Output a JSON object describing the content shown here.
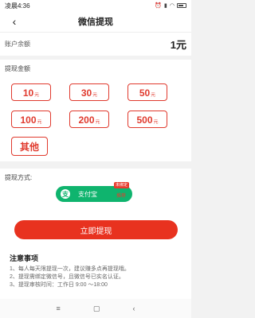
{
  "status": {
    "time": "凌晨4:36",
    "icons": [
      "alarm-icon",
      "signal-icon",
      "wifi-icon",
      "battery-icon"
    ]
  },
  "header": {
    "title": "微信提现",
    "back_icon": "‹"
  },
  "balance": {
    "label": "账户余额",
    "value": "1元"
  },
  "amounts": {
    "label": "提现金额",
    "options": [
      {
        "value": "10",
        "unit": "元"
      },
      {
        "value": "30",
        "unit": "元"
      },
      {
        "value": "50",
        "unit": "元"
      },
      {
        "value": "100",
        "unit": "元"
      },
      {
        "value": "200",
        "unit": "元"
      },
      {
        "value": "500",
        "unit": "元"
      }
    ],
    "other_label": "其他"
  },
  "method": {
    "label": "提现方式:",
    "alipay": {
      "icon": "支",
      "label": "支付宝",
      "badge": "未绑定",
      "tag": "推荐"
    }
  },
  "submit_label": "立即提现",
  "notes": {
    "title": "注意事项",
    "items": [
      "1、每人每天限提现一次，建议赚多点再提现哦。",
      "2、提现需绑定微信号，且微信号已实名认证。",
      "3、提现审核时间：工作日 9:00 ～18:00"
    ]
  },
  "nav": {
    "menu_icon": "≡",
    "home_icon": "▢",
    "back_icon": "‹"
  },
  "colors": {
    "accent": "#e8321f",
    "alipay": "#0fb46e"
  }
}
